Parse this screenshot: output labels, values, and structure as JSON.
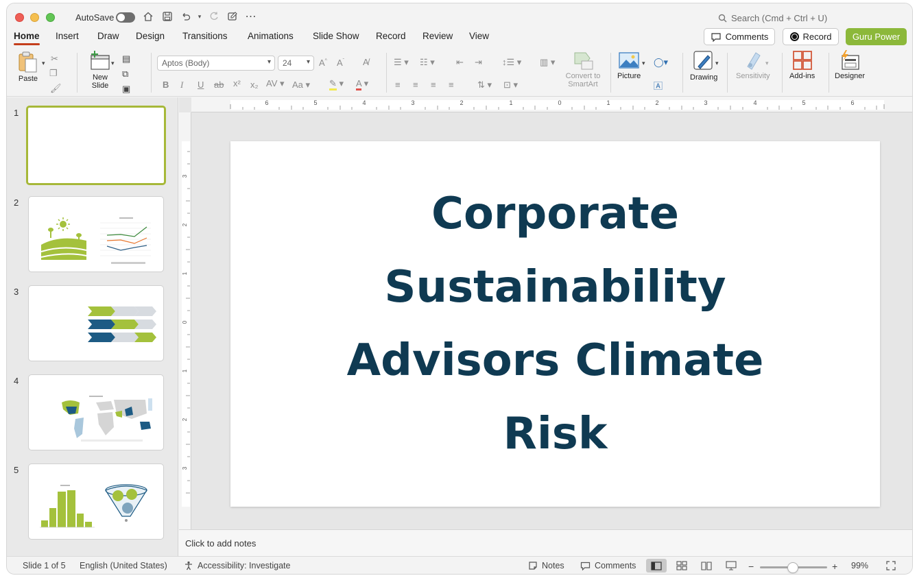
{
  "titlebar": {
    "autosave_label": "AutoSave",
    "autosave_state": "off",
    "search_placeholder": "Search (Cmd + Ctrl + U)"
  },
  "menu": {
    "tabs": [
      {
        "label": "Home",
        "active": true
      },
      {
        "label": "Insert",
        "active": false
      },
      {
        "label": "Draw",
        "active": false
      },
      {
        "label": "Design",
        "active": false
      },
      {
        "label": "Transitions",
        "active": false
      },
      {
        "label": "Animations",
        "active": false
      },
      {
        "label": "Slide Show",
        "active": false
      },
      {
        "label": "Record",
        "active": false
      },
      {
        "label": "Review",
        "active": false
      },
      {
        "label": "View",
        "active": false
      }
    ],
    "comments_label": "Comments",
    "record_label": "Record",
    "guru_label": "Guru Power"
  },
  "ribbon": {
    "paste_label": "Paste",
    "new_slide_label": "New Slide",
    "font_name": "Aptos (Body)",
    "font_size": "24",
    "convert_label": "Convert to SmartArt",
    "picture_label": "Picture",
    "drawing_label": "Drawing",
    "sensitivity_label": "Sensitivity",
    "addins_label": "Add-ins",
    "designer_label": "Designer"
  },
  "thumbnails": [
    {
      "number": "1",
      "selected": true
    },
    {
      "number": "2",
      "selected": false
    },
    {
      "number": "3",
      "selected": false
    },
    {
      "number": "4",
      "selected": false
    },
    {
      "number": "5",
      "selected": false
    }
  ],
  "slide": {
    "title": "Corporate Sustainability Advisors Climate Risk",
    "title_color": "#0f3a52"
  },
  "notes_placeholder": "Click to add notes",
  "status": {
    "slide_position": "Slide 1 of 5",
    "language": "English (United States)",
    "accessibility": "Accessibility: Investigate",
    "notes_label": "Notes",
    "comments_label": "Comments",
    "zoom": "99%"
  },
  "colors": {
    "accent_tab": "#c43e1c",
    "guru_button": "#8cb83a",
    "selection_border": "#a6b838"
  }
}
